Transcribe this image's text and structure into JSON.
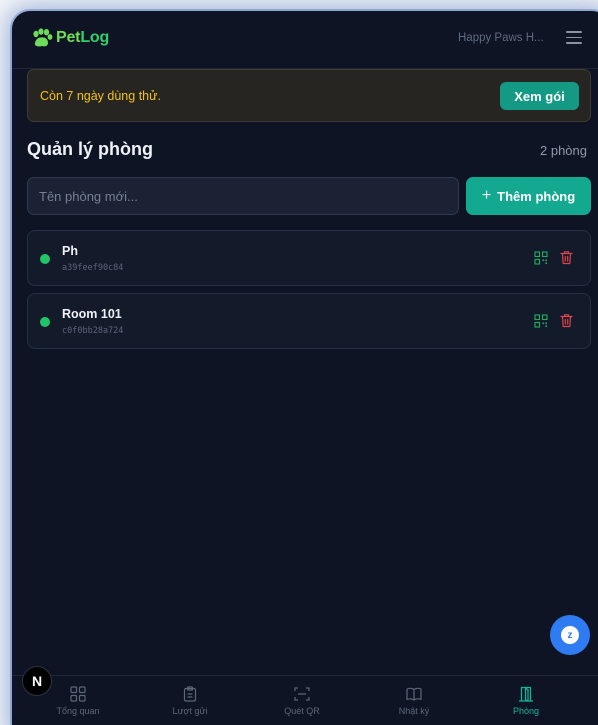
{
  "header": {
    "logo_text_a": "Pet",
    "logo_text_b": "Log",
    "clinic_name": "Happy Paws H..."
  },
  "trial": {
    "message": "Còn 7 ngày dùng thử.",
    "button": "Xem gói"
  },
  "page": {
    "title": "Quản lý phòng",
    "count": "2 phòng"
  },
  "form": {
    "placeholder": "Tên phòng mới...",
    "value": "",
    "add_button": "Thêm phòng"
  },
  "rooms": [
    {
      "name": "Ph",
      "id": "a39feef90c84",
      "status_color": "#23c468"
    },
    {
      "name": "Room 101",
      "id": "c0f0bb28a724",
      "status_color": "#23c468"
    }
  ],
  "nav": [
    {
      "label": "Tổng quan",
      "icon": "dashboard-icon",
      "active": false
    },
    {
      "label": "Lượt gửi",
      "icon": "clipboard-icon",
      "active": false
    },
    {
      "label": "Quét QR",
      "icon": "scan-icon",
      "active": false
    },
    {
      "label": "Nhật ký",
      "icon": "book-icon",
      "active": false
    },
    {
      "label": "Phòng",
      "icon": "door-icon",
      "active": true
    }
  ],
  "badge": "N",
  "chat_icon_letter": "z",
  "colors": {
    "accent": "#13a890",
    "background": "#0e1424",
    "warning": "#f2c218",
    "status_online": "#23c468",
    "danger": "#e0434b"
  }
}
